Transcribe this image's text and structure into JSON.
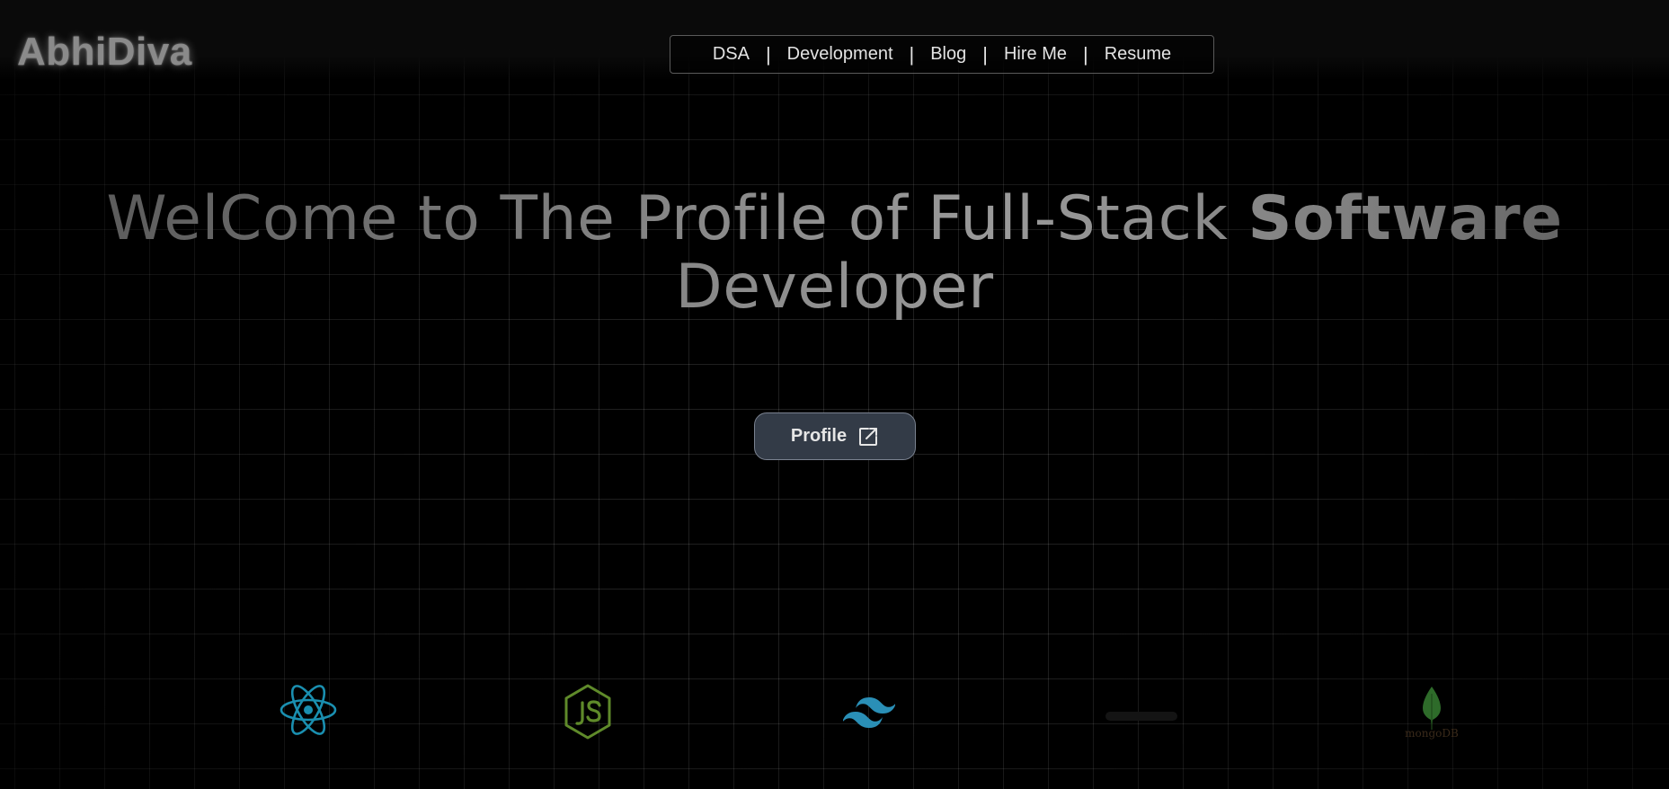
{
  "brand": {
    "logo": "AbhiDiva"
  },
  "nav": {
    "items": [
      "DSA",
      "Development",
      "Blog",
      "Hire Me",
      "Resume"
    ],
    "separator": "|"
  },
  "hero": {
    "title_part1": "WelCome to The Profile of Full-Stack ",
    "title_bold": "Software",
    "title_part2": "Developer"
  },
  "cta": {
    "profile_label": "Profile",
    "icon": "external-link-icon"
  },
  "tech_icons": [
    {
      "name": "react-icon",
      "color": "#1a8fb0"
    },
    {
      "name": "nodejs-icon",
      "color": "#5f8a2a"
    },
    {
      "name": "tailwind-icon",
      "color": "#2a8fb6"
    },
    {
      "name": "nextjs-icon",
      "color": "#1a1a1a"
    },
    {
      "name": "mongodb-icon",
      "color": "#2e6b2a",
      "wordmark": "mongoDB"
    }
  ],
  "colors": {
    "background": "#000000",
    "button_bg": "#333b47",
    "text": "#e3e3e3"
  }
}
